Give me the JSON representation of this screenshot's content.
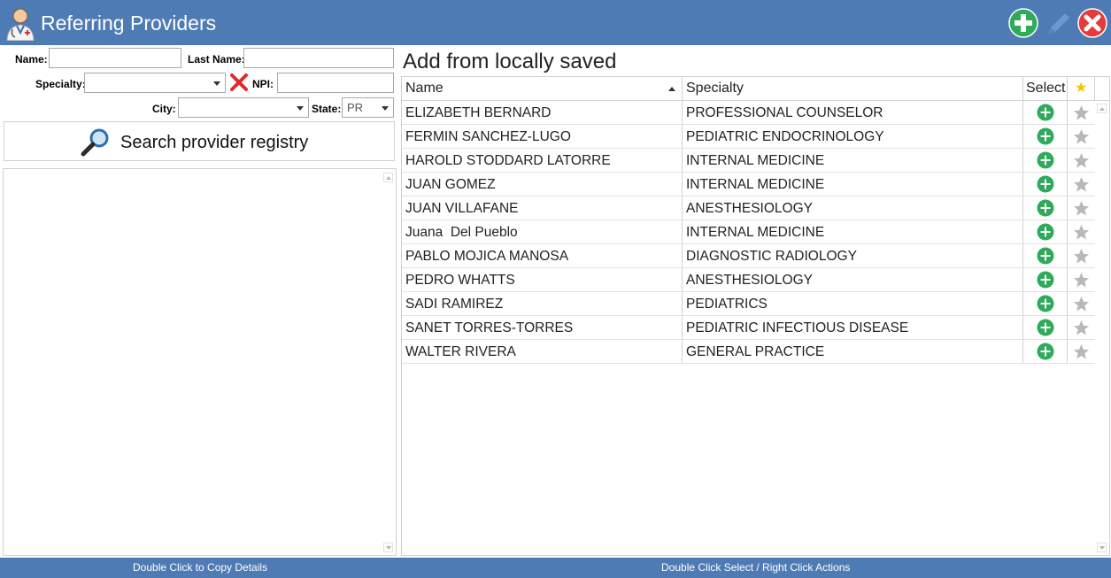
{
  "window": {
    "title": "Referring Providers",
    "icon": "doctor-avatar-icon",
    "actions": [
      {
        "name": "add-button",
        "icon": "plus-circle-icon",
        "color": "#2eaa5a"
      },
      {
        "name": "edit-button",
        "icon": "pencil-icon",
        "color": "#6f9bd0"
      },
      {
        "name": "close-button",
        "icon": "x-circle-icon",
        "color": "#e53b3b"
      }
    ]
  },
  "form": {
    "name_label": "Name:",
    "name_value": "",
    "last_name_label": "Last Name:",
    "last_name_value": "",
    "specialty_label": "Specialty:",
    "specialty_value": "",
    "npi_label": "NPI:",
    "npi_value": "",
    "city_label": "City:",
    "city_value": "",
    "state_label": "State:",
    "state_value": "PR",
    "clear_icon": "red-x-icon"
  },
  "search_button": {
    "label": "Search provider registry",
    "icon": "magnifier-icon"
  },
  "local": {
    "title": "Add from locally saved",
    "columns": {
      "name": "Name",
      "specialty": "Specialty",
      "select": "Select",
      "favorite": "★"
    },
    "sort": {
      "column": "Name",
      "direction": "ascending"
    },
    "rows": [
      {
        "name": "ELIZABETH BERNARD",
        "specialty": "PROFESSIONAL COUNSELOR"
      },
      {
        "name": "FERMIN SANCHEZ-LUGO",
        "specialty": "PEDIATRIC ENDOCRINOLOGY"
      },
      {
        "name": "HAROLD STODDARD LATORRE",
        "specialty": "INTERNAL MEDICINE"
      },
      {
        "name": "JUAN GOMEZ",
        "specialty": "INTERNAL MEDICINE"
      },
      {
        "name": "JUAN VILLAFANE",
        "specialty": "ANESTHESIOLOGY"
      },
      {
        "name": "Juana  Del Pueblo",
        "specialty": "INTERNAL MEDICINE"
      },
      {
        "name": "PABLO MOJICA MANOSA",
        "specialty": "DIAGNOSTIC RADIOLOGY"
      },
      {
        "name": "PEDRO WHATTS",
        "specialty": "ANESTHESIOLOGY"
      },
      {
        "name": "SADI RAMIREZ",
        "specialty": "PEDIATRICS"
      },
      {
        "name": "SANET TORRES-TORRES",
        "specialty": "PEDIATRIC INFECTIOUS DISEASE"
      },
      {
        "name": "WALTER RIVERA",
        "specialty": "GENERAL PRACTICE"
      }
    ]
  },
  "status": {
    "left": "Double Click to Copy Details",
    "right": "Double Click Select / Right Click Actions"
  },
  "colors": {
    "titlebar": "#4f7bb5",
    "select_plus": "#2eaa5a",
    "star_inactive": "#b8b8b8",
    "star_header": "#f2c500"
  }
}
